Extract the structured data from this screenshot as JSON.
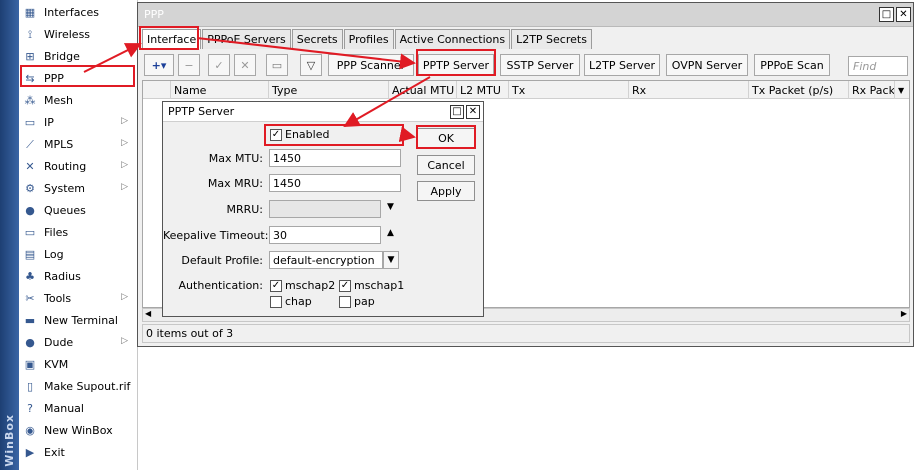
{
  "sidebar": {
    "strip_text": "WinBox",
    "items": [
      {
        "label": "Interfaces",
        "icon": "interfaces-icon",
        "glyph": "▦",
        "submenu": false
      },
      {
        "label": "Wireless",
        "icon": "wireless-icon",
        "glyph": "⟟",
        "submenu": false
      },
      {
        "label": "Bridge",
        "icon": "bridge-icon",
        "glyph": "⊞",
        "submenu": false
      },
      {
        "label": "PPP",
        "icon": "ppp-icon",
        "glyph": "⇆",
        "submenu": false
      },
      {
        "label": "Mesh",
        "icon": "mesh-icon",
        "glyph": "⁂",
        "submenu": false
      },
      {
        "label": "IP",
        "icon": "ip-icon",
        "glyph": "▭",
        "submenu": true
      },
      {
        "label": "MPLS",
        "icon": "mpls-icon",
        "glyph": "⟋",
        "submenu": true
      },
      {
        "label": "Routing",
        "icon": "routing-icon",
        "glyph": "✕",
        "submenu": true
      },
      {
        "label": "System",
        "icon": "system-icon",
        "glyph": "⚙",
        "submenu": true
      },
      {
        "label": "Queues",
        "icon": "queues-icon",
        "glyph": "●",
        "submenu": false
      },
      {
        "label": "Files",
        "icon": "files-icon",
        "glyph": "▭",
        "submenu": false
      },
      {
        "label": "Log",
        "icon": "log-icon",
        "glyph": "▤",
        "submenu": false
      },
      {
        "label": "Radius",
        "icon": "radius-icon",
        "glyph": "♣",
        "submenu": false
      },
      {
        "label": "Tools",
        "icon": "tools-icon",
        "glyph": "✂",
        "submenu": true
      },
      {
        "label": "New Terminal",
        "icon": "terminal-icon",
        "glyph": "▬",
        "submenu": false
      },
      {
        "label": "Dude",
        "icon": "dude-icon",
        "glyph": "●",
        "submenu": true
      },
      {
        "label": "KVM",
        "icon": "kvm-icon",
        "glyph": "▣",
        "submenu": false
      },
      {
        "label": "Make Supout.rif",
        "icon": "supout-icon",
        "glyph": "▯",
        "submenu": false
      },
      {
        "label": "Manual",
        "icon": "manual-icon",
        "glyph": "?",
        "submenu": false
      },
      {
        "label": "New WinBox",
        "icon": "winbox-icon",
        "glyph": "◉",
        "submenu": false
      },
      {
        "label": "Exit",
        "icon": "exit-icon",
        "glyph": "▶",
        "submenu": false
      }
    ]
  },
  "ppp_window": {
    "title": "PPP",
    "tabs": [
      "Interface",
      "PPPoE Servers",
      "Secrets",
      "Profiles",
      "Active Connections",
      "L2TP Secrets"
    ],
    "toolbar": {
      "add_glyph": "+▾",
      "buttons": [
        "PPP Scanner",
        "PPTP Server",
        "SSTP Server",
        "L2TP Server",
        "OVPN Server",
        "PPPoE Scan"
      ],
      "find_placeholder": "Find"
    },
    "columns": [
      "Name",
      "Type",
      "Actual MTU",
      "L2 MTU",
      "Tx",
      "Rx",
      "Tx Packet (p/s)",
      "Rx Pack"
    ],
    "status": "0 items out of 3"
  },
  "dialog": {
    "title": "PPTP Server",
    "enabled_label": "Enabled",
    "enabled_checked": true,
    "fields": {
      "max_mtu": {
        "label": "Max MTU:",
        "value": "1450"
      },
      "max_mru": {
        "label": "Max MRU:",
        "value": "1450"
      },
      "mrru": {
        "label": "MRRU:",
        "value": ""
      },
      "keepalive": {
        "label": "Keepalive Timeout:",
        "value": "30"
      },
      "profile": {
        "label": "Default Profile:",
        "value": "default-encryption"
      },
      "auth": {
        "label": "Authentication:"
      }
    },
    "auth_options": [
      {
        "label": "mschap2",
        "checked": true
      },
      {
        "label": "mschap1",
        "checked": true
      },
      {
        "label": "chap",
        "checked": false
      },
      {
        "label": "pap",
        "checked": false
      }
    ],
    "buttons": {
      "ok": "OK",
      "cancel": "Cancel",
      "apply": "Apply"
    }
  },
  "colors": {
    "highlight": "#e01b24",
    "sidebar_strip": "#2c5490"
  }
}
